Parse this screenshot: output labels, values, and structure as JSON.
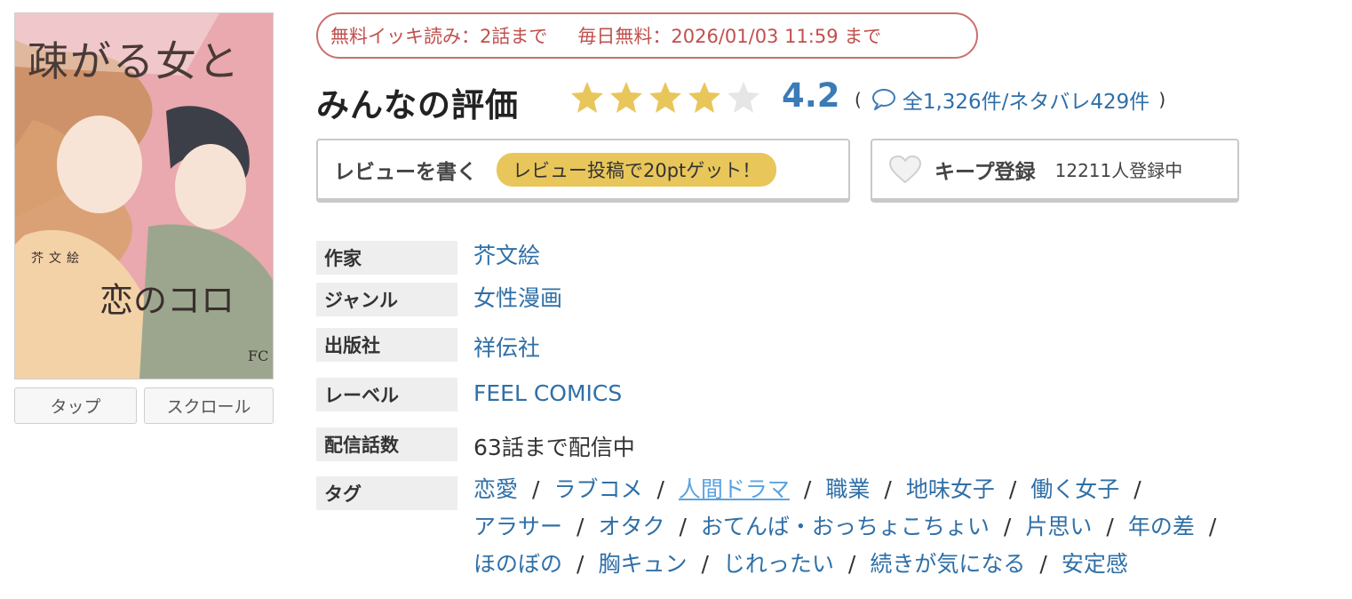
{
  "cover": {
    "title_line1": "疎がる女と",
    "title_line2": "恋のコロ",
    "author_mark": "芥文絵",
    "publisher_mark": "FC",
    "colors": {
      "background": "#e9a9ae",
      "accent": "#f6d6a6"
    }
  },
  "view_buttons": {
    "tap": "タップ",
    "scroll": "スクロール"
  },
  "free_badge": {
    "text1": "無料イッキ読み：2話まで",
    "text2": "毎日無料：2026/01/03 11:59 まで",
    "color": "#c0504d"
  },
  "rating": {
    "title": "みんなの評価",
    "stars_filled": 4,
    "stars_total": 5,
    "score": "4.2",
    "open_paren": "(",
    "counts": "全1,326件/ネタバレ429件",
    "close_paren": ")",
    "star_color": "#e8c65a",
    "empty_star_color": "#e6e6e6"
  },
  "actions": {
    "review_label": "レビューを書く",
    "review_promo": "レビュー投稿で20ptゲット！",
    "keep_label": "キープ登録",
    "keep_count": "12211人登録中"
  },
  "info": {
    "author_label": "作家",
    "author": "芥文絵",
    "genre_label": "ジャンル",
    "genre": "女性漫画",
    "publisher_label": "出版社",
    "publisher": "祥伝社",
    "label_label": "レーベル",
    "label": "FEEL COMICS",
    "episodes_label": "配信話数",
    "episodes": "63話まで配信中",
    "tags_label": "タグ"
  },
  "tags": [
    [
      "恋愛",
      "ラブコメ",
      "人間ドラマ",
      "職業",
      "地味女子",
      "働く女子"
    ],
    [
      "アラサー",
      "オタク",
      "おてんば・おっちょこちょい",
      "片思い",
      "年の差"
    ],
    [
      "ほのぼの",
      "胸キュン",
      "じれったい",
      "続きが気になる",
      "安定感"
    ]
  ],
  "tag_separator": "/",
  "active_tag": "人間ドラマ"
}
